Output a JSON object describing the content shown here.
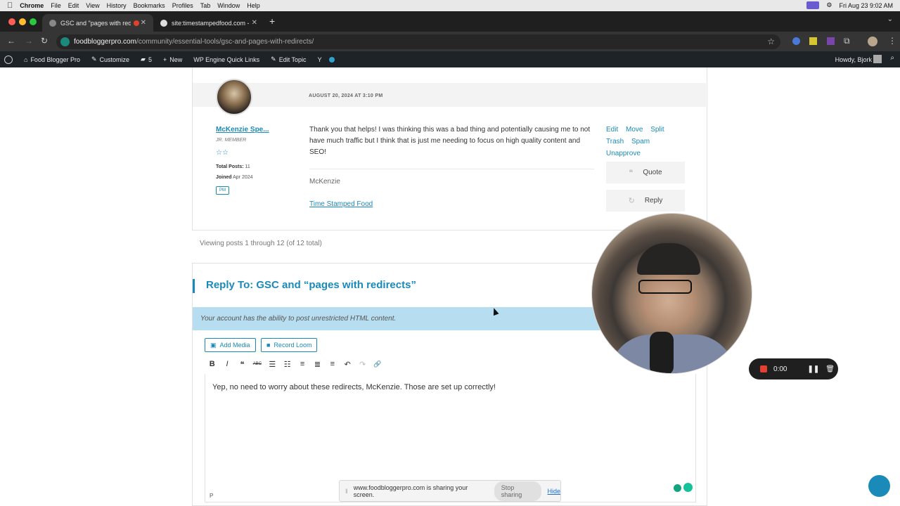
{
  "mac": {
    "apple": "",
    "app": "Chrome",
    "menus": [
      "File",
      "Edit",
      "View",
      "History",
      "Bookmarks",
      "Profiles",
      "Tab",
      "Window",
      "Help"
    ],
    "clock": "Fri Aug 23  9:02 AM"
  },
  "browser": {
    "tabs": [
      {
        "title": "GSC and \"pages with red"
      },
      {
        "title": "site:timestampedfood.com - "
      }
    ],
    "url_host": "foodbloggerpro.com",
    "url_path": "/community/essential-tools/gsc-and-pages-with-redirects/"
  },
  "wpbar": {
    "items": [
      "Food Blogger Pro",
      "Customize",
      "5",
      "New",
      "WP Engine Quick Links",
      "Edit Topic"
    ],
    "greeting": "Howdy, Bjork"
  },
  "post": {
    "date": "AUGUST 20, 2024 AT 3:10 PM",
    "author": "McKenzie Spe...",
    "role": "JR. MEMBER",
    "stars": "☆☆",
    "total_posts_label": "Total Posts:",
    "total_posts": "11",
    "joined_label": "Joined",
    "joined": "Apr 2024",
    "pm": "PM",
    "message": "Thank you that helps! I was thinking this was a bad thing and potentially causing me to not have much traffic but I think that is just me needing to focus on high quality content and SEO!",
    "signature_name": "McKenzie",
    "signature_link": "Time Stamped Food",
    "actions": [
      "Edit",
      "Move",
      "Split",
      "Trash",
      "Spam",
      "Unapprove"
    ],
    "quote_label": "Quote",
    "reply_label": "Reply"
  },
  "viewing": "Viewing posts 1 through 12 (of 12 total)",
  "reply": {
    "title": "Reply To: GSC and “pages with redirects”",
    "notice": "Your account has the ability to post unrestricted HTML content.",
    "add_media": "Add Media",
    "record_loom": "Record Loom",
    "toolbar": [
      "B",
      "I",
      "❝",
      "ABC",
      "☰",
      "☷",
      "≡",
      "≣",
      "≡",
      "↶",
      "↷",
      "🔗"
    ],
    "body": "Yep, no need to worry about these redirects, McKenzie. Those are set up correctly!",
    "path": "P"
  },
  "recorder": {
    "time": "0:00"
  },
  "share": {
    "message": "www.foodbloggerpro.com is sharing your screen.",
    "stop": "Stop sharing",
    "hide": "Hide"
  },
  "colors": {
    "accent": "#1a8ab8",
    "notice": "#b7ddf0",
    "wpbar": "#1d2327"
  }
}
